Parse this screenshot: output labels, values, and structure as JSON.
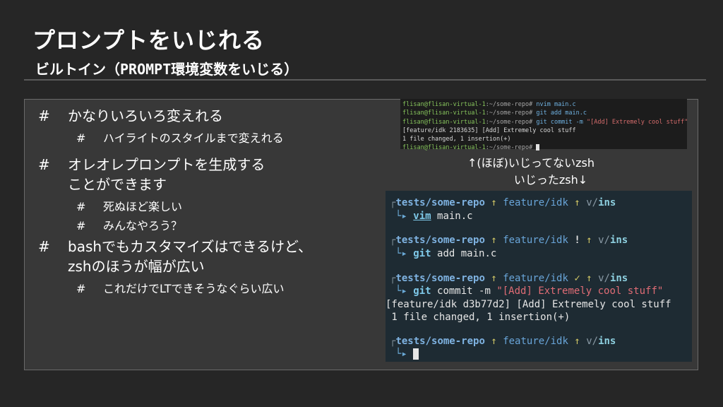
{
  "slide": {
    "title": "プロンプトをいじれる",
    "subtitle": "ビルトイン（PROMPT環境変数をいじる）"
  },
  "bullets": {
    "mark": "#",
    "b1": "かなりいろいろ変えれる",
    "b1_1": "ハイライトのスタイルまで変えれる",
    "b2_line1": "オレオレプロンプトを生成する",
    "b2_line2": "ことができます",
    "b2_1": "死ぬほど楽しい",
    "b2_2": "みんなやろう？",
    "b3_line1": "bashでもカスタマイズはできるけど、",
    "b3_line2": "zshのほうが幅が広い",
    "b3_1": "これだけでLTできそうなぐらい広い"
  },
  "terminal_plain": {
    "user": "flisan@flisan-virtual-1",
    "path": ":~/some-repo# ",
    "cmd1": "nvim main.c",
    "cmd2": "git add main.c",
    "cmd3_a": "git commit -m ",
    "cmd3_b": "\"[Add] Extremely cool stuff\"",
    "out1": "[feature/idk 2183635] [Add] Extremely cool stuff",
    "out2": "1 file changed, 1 insertion(+)"
  },
  "captions": {
    "top": "↑(ほぼ)いじってないzsh",
    "bottom": "いじったzsh↓"
  },
  "terminal_zsh": {
    "repo": "tests/some-repo",
    "arrow_up": "↑",
    "branch": "feature/idk",
    "mode_prefix": "v/",
    "mode": "ins",
    "excl": "!",
    "check": "✓",
    "corner": "┌",
    "elbow": "└▸",
    "cmd1_a": "vim",
    "cmd1_b": " main.c",
    "cmd2_a": "git",
    "cmd2_b": " add main.c",
    "cmd3_a": "git",
    "cmd3_b": " commit -m ",
    "cmd3_c": "\"[Add] Extremely cool stuff\"",
    "out1": "[feature/idk d3b77d2] [Add] Extremely cool stuff",
    "out2": " 1 file changed, 1 insertion(+)"
  }
}
